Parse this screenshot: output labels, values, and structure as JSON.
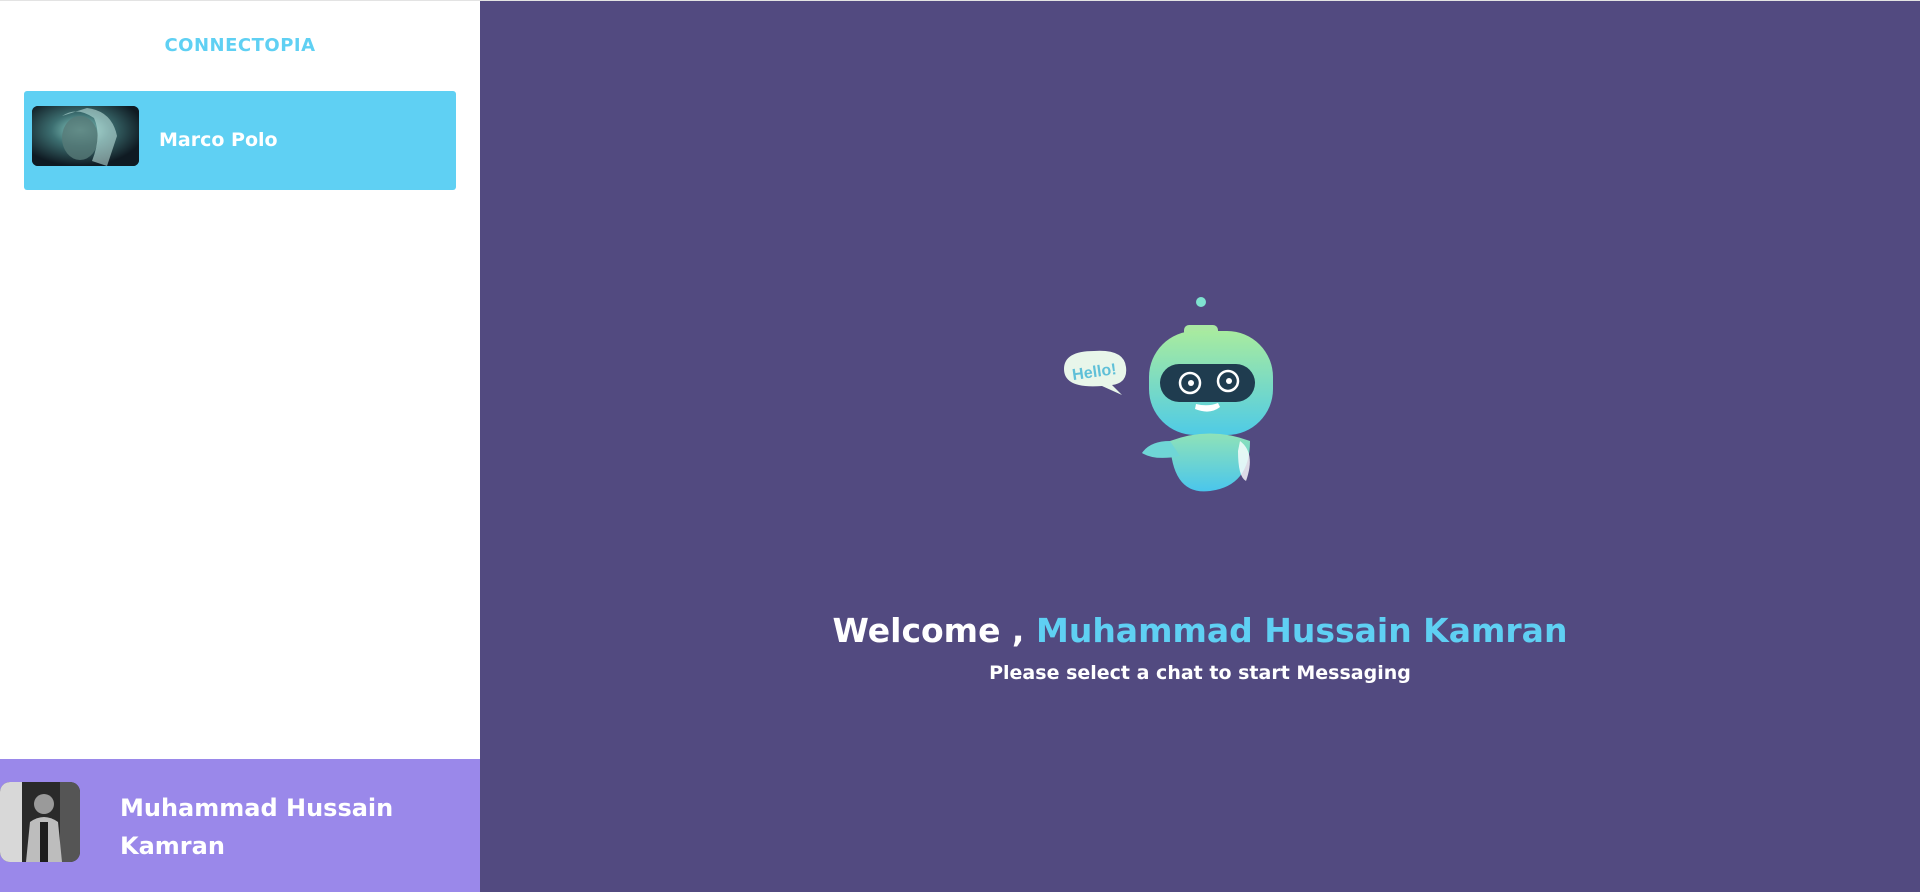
{
  "sidebar": {
    "brand": "CONNECTOPIA",
    "contacts": [
      {
        "name": "Marco Polo"
      }
    ]
  },
  "current_user": {
    "name": "Muhammad Hussain Kamran"
  },
  "main": {
    "welcome_prefix": "Welcome ,",
    "welcome_name": "Muhammad Hussain Kamran",
    "subtitle": "Please select a chat to start Messaging",
    "bubble_text": "Hello!"
  },
  "colors": {
    "accent": "#5fd0f3",
    "main_bg": "#524a80",
    "user_bar": "#9a88ea"
  }
}
